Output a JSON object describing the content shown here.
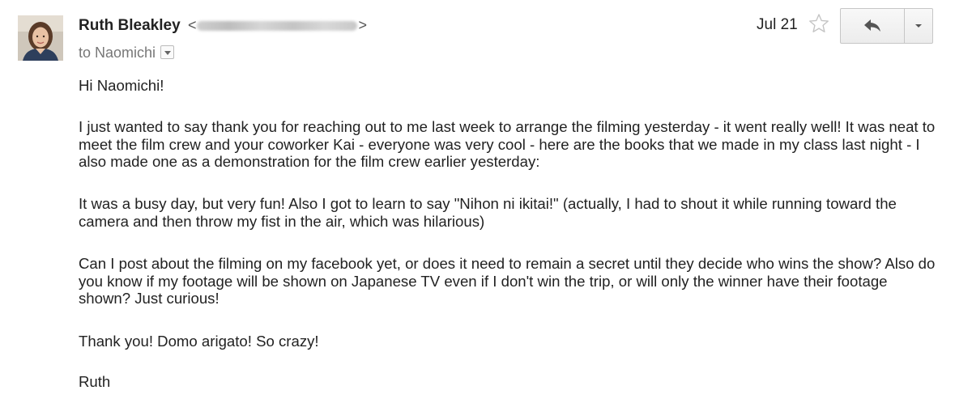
{
  "message": {
    "sender": {
      "name": "Ruth Bleakley",
      "email_open": "<",
      "email_close": ">"
    },
    "recipient": {
      "prefix": "to",
      "name": "Naomichi"
    },
    "date": "Jul 21",
    "icons": {
      "avatar": "avatar-photo",
      "star": "star-outline-icon",
      "reply": "reply-arrow-icon",
      "more": "chevron-down-icon"
    },
    "body": {
      "greeting": "Hi Naomichi!",
      "paragraph_1": "I just wanted to say thank you for reaching out to me last week to arrange the filming yesterday - it went really well! It was neat to meet the film crew and your coworker Kai - everyone was very cool - here are the books that we made in my class last night - I also made one as a demonstration for the film crew earlier yesterday:",
      "paragraph_2": "It was a busy day, but very fun! Also I got to learn to say \"Nihon ni ikitai!\" (actually, I had to shout it while running toward the camera and then throw my fist in the air, which was hilarious)",
      "paragraph_3": "Can I post about the filming on my facebook yet, or does it need to remain a secret until they decide who wins the show? Also do you know if my footage will be shown on Japanese TV even if I don't win the trip, or will only the winner have their footage shown? Just curious!",
      "closing": "Thank you! Domo arigato! So crazy!",
      "signature": "Ruth"
    }
  }
}
